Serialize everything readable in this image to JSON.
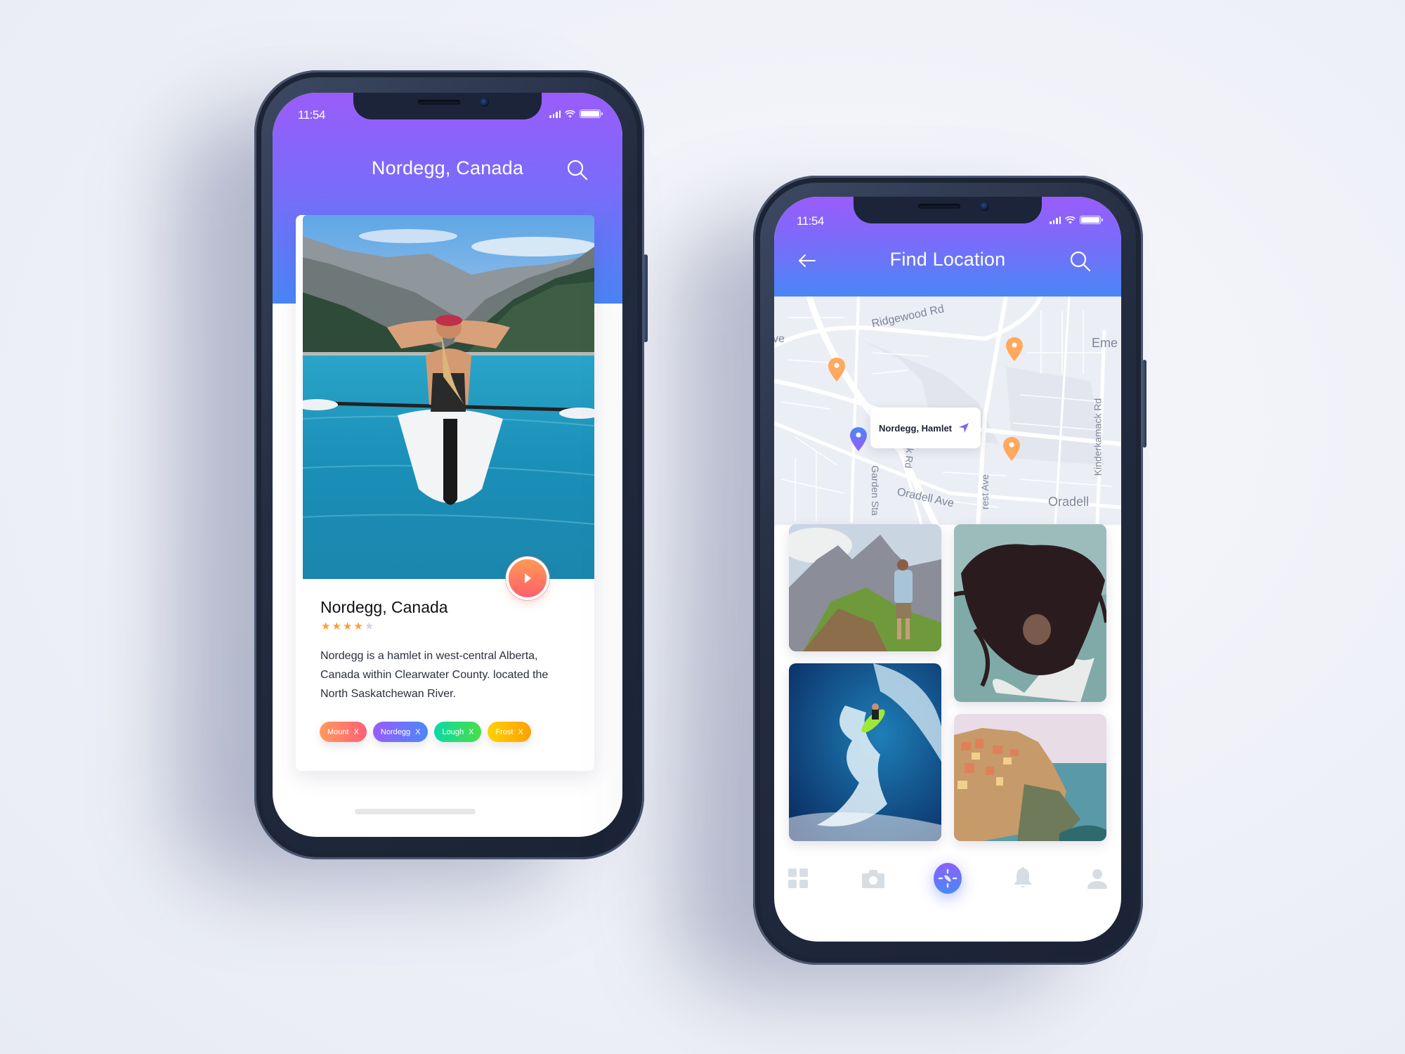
{
  "phone_left": {
    "status": {
      "time": "11:54"
    },
    "header": {
      "title": "Nordegg, Canada",
      "search_icon": "search-icon"
    },
    "card": {
      "photo_alt": "Woman in kayak on mountain lake",
      "title": "Nordegg, Canada",
      "rating": {
        "value": 4,
        "max": 5
      },
      "description": "Nordegg is a hamlet in west-central Alberta, Canada within Clearwater County. located the North Saskatchewan River.",
      "play_icon": "play-icon",
      "tags": [
        {
          "label": "Mount",
          "remove": "X",
          "colors": [
            "#ff9b5a",
            "#ff5f76"
          ]
        },
        {
          "label": "Nordegg",
          "remove": "X",
          "colors": [
            "#9a5cfa",
            "#4a88f8"
          ]
        },
        {
          "label": "Lough",
          "remove": "X",
          "colors": [
            "#0ad9a8",
            "#4ade44"
          ]
        },
        {
          "label": "Frost",
          "remove": "X",
          "colors": [
            "#ffd200",
            "#ffa000"
          ]
        }
      ]
    }
  },
  "phone_right": {
    "status": {
      "time": "11:54"
    },
    "header": {
      "title": "Find Location",
      "back_icon": "arrow-left-icon",
      "search_icon": "search-icon"
    },
    "map": {
      "labels": [
        {
          "text": "Ridgewood Rd"
        },
        {
          "text": "ve"
        },
        {
          "text": "Eme"
        },
        {
          "text": "Kinderkamack Rd"
        },
        {
          "text": "Garden Sta"
        },
        {
          "text": "k Rd"
        },
        {
          "text": "Oradell Ave"
        },
        {
          "text": "rest Ave"
        },
        {
          "text": "Oradell"
        }
      ],
      "callout": {
        "label": "Nordegg, Hamlet",
        "icon": "navigation-arrow-icon"
      },
      "selected_pin_color": "#5a78f8",
      "pin_color": "#ffa95e"
    },
    "gallery": [
      {
        "alt": "Man looking at mountain peaks"
      },
      {
        "alt": "Woman with windblown hair by the sea"
      },
      {
        "alt": "Surfer riding a big wave"
      },
      {
        "alt": "Cliffside colorful village by the sea"
      }
    ],
    "bottom_nav": [
      {
        "name": "home",
        "icon": "grid-icon",
        "active": false
      },
      {
        "name": "camera",
        "icon": "camera-icon",
        "active": false
      },
      {
        "name": "explore",
        "icon": "compass-icon",
        "active": true
      },
      {
        "name": "notifications",
        "icon": "bell-icon",
        "active": false
      },
      {
        "name": "profile",
        "icon": "user-icon",
        "active": false
      }
    ]
  },
  "colors": {
    "header_top": "#9a5cfa",
    "header_bottom": "#4a86f6",
    "star_filled": "#ff9f2e",
    "star_empty": "#cfd6df",
    "nav_inactive": "#d7dde3"
  }
}
